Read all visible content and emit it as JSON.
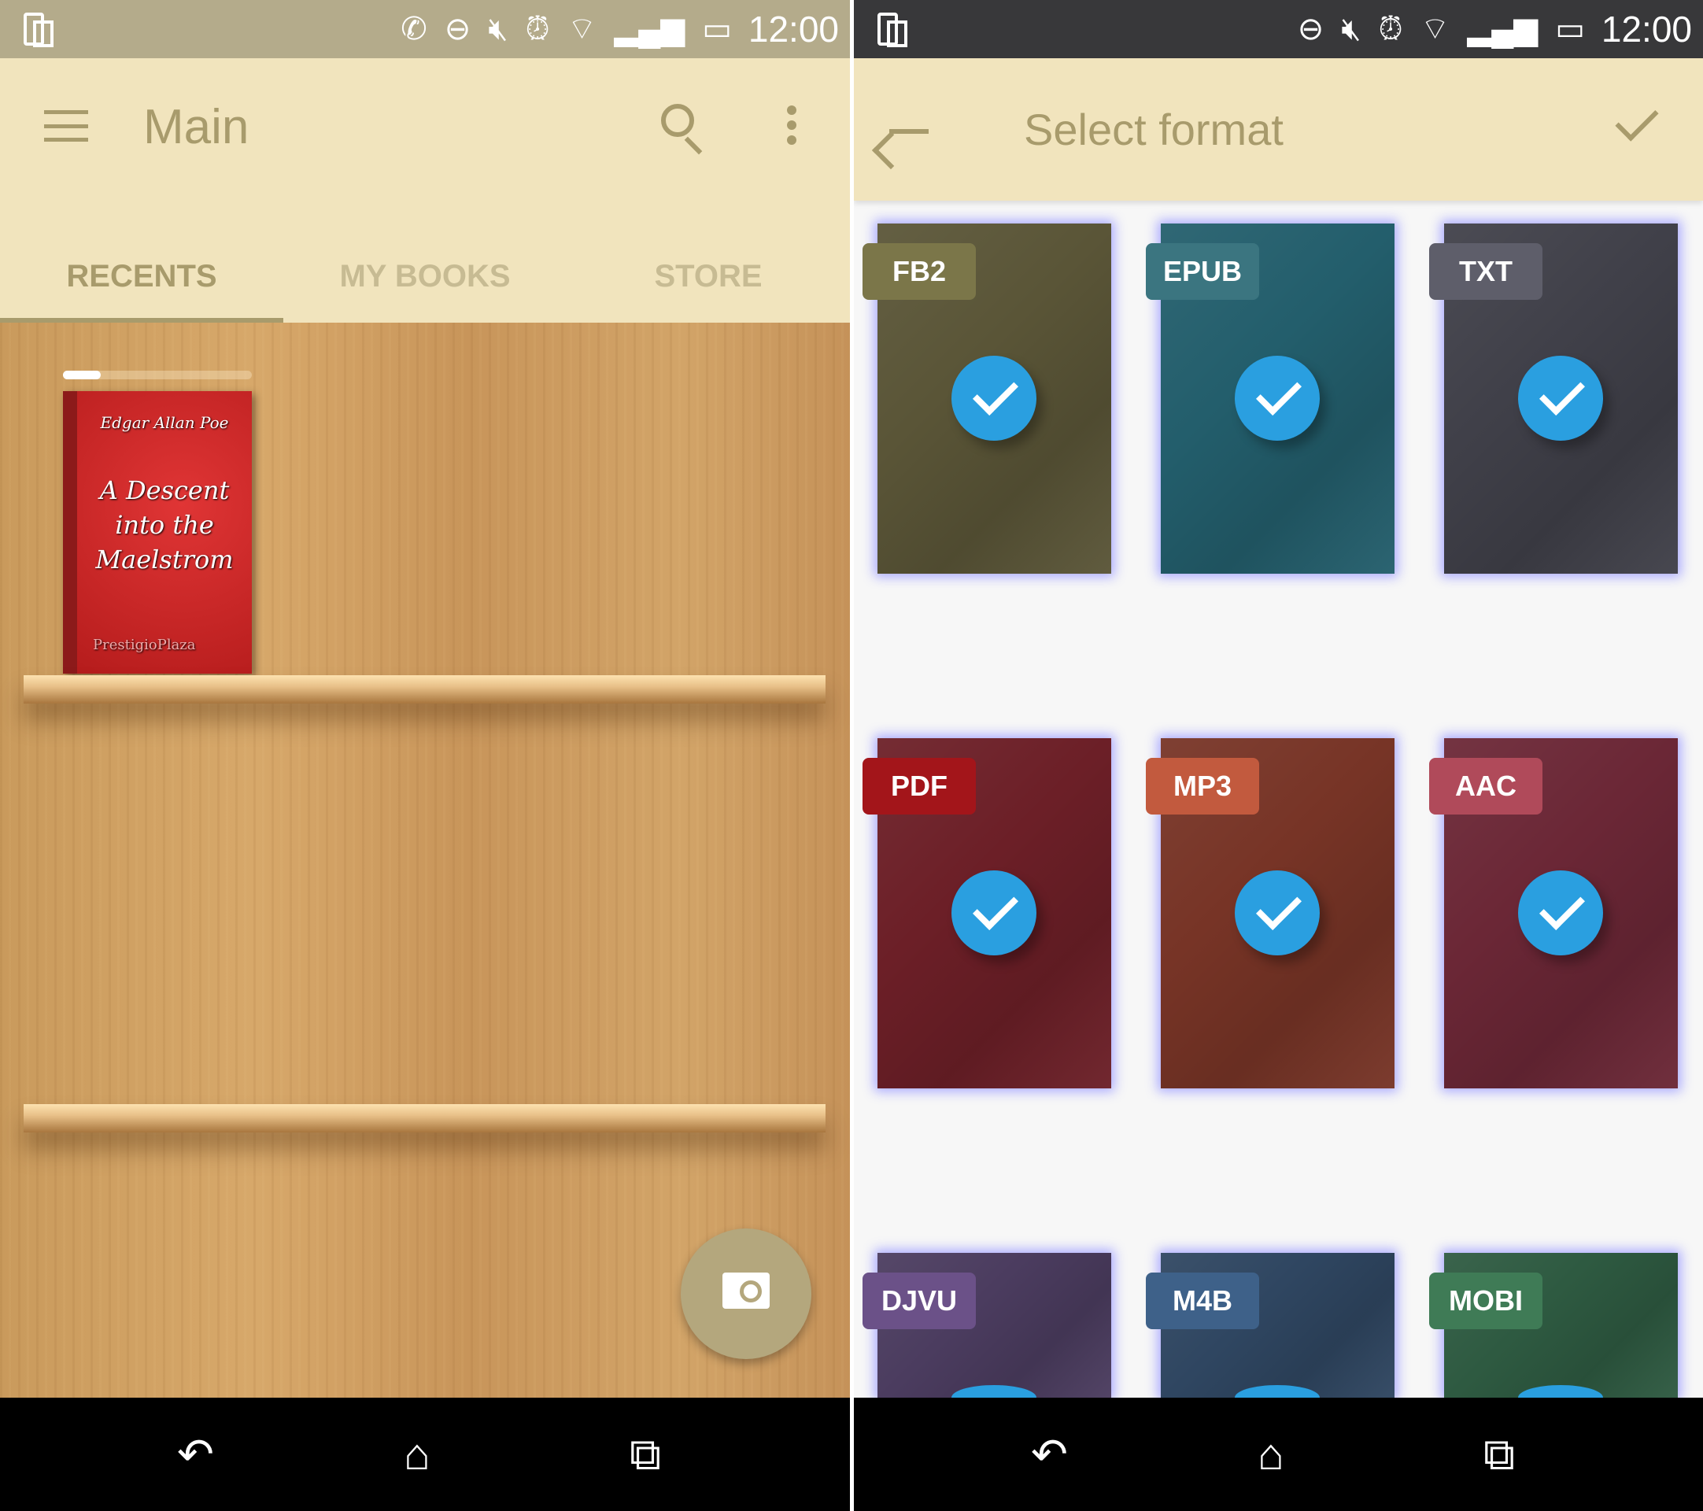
{
  "status_bar": {
    "time": "12:00"
  },
  "main": {
    "title": "Main",
    "tabs": [
      {
        "label": "RECENTS",
        "active": true
      },
      {
        "label": "MY BOOKS",
        "active": false
      },
      {
        "label": "STORE",
        "active": false
      }
    ],
    "recent_book": {
      "author": "Edgar Allan Poe",
      "title": "A Descent into the Maelstrom",
      "publisher": "PrestigioPlaza",
      "progress_percent": 20
    }
  },
  "select_format": {
    "title": "Select format",
    "formats": [
      {
        "label": "FB2",
        "checked": true,
        "tile": "#5a5537",
        "badge": "#7b7649"
      },
      {
        "label": "EPUB",
        "checked": true,
        "tile": "#235e6c",
        "badge": "#3b7580"
      },
      {
        "label": "TXT",
        "checked": true,
        "tile": "#404049",
        "badge": "#5e5e6a"
      },
      {
        "label": "PDF",
        "checked": true,
        "tile": "#6c1f27",
        "badge": "#a3151a"
      },
      {
        "label": "MP3",
        "checked": true,
        "tile": "#773426",
        "badge": "#c25a3e"
      },
      {
        "label": "AAC",
        "checked": true,
        "tile": "#6b2736",
        "badge": "#b04a5a"
      },
      {
        "label": "DJVU",
        "checked": true,
        "tile": "#4b3c5f",
        "badge": "#6b5188"
      },
      {
        "label": "M4B",
        "checked": true,
        "tile": "#2f4661",
        "badge": "#3e6189"
      },
      {
        "label": "MOBI",
        "checked": true,
        "tile": "#2e5a41",
        "badge": "#3f7b56"
      }
    ]
  },
  "colors": {
    "accent": "#a89b6c",
    "check": "#2a9fe0",
    "toolbar": "#f1e4bd"
  }
}
